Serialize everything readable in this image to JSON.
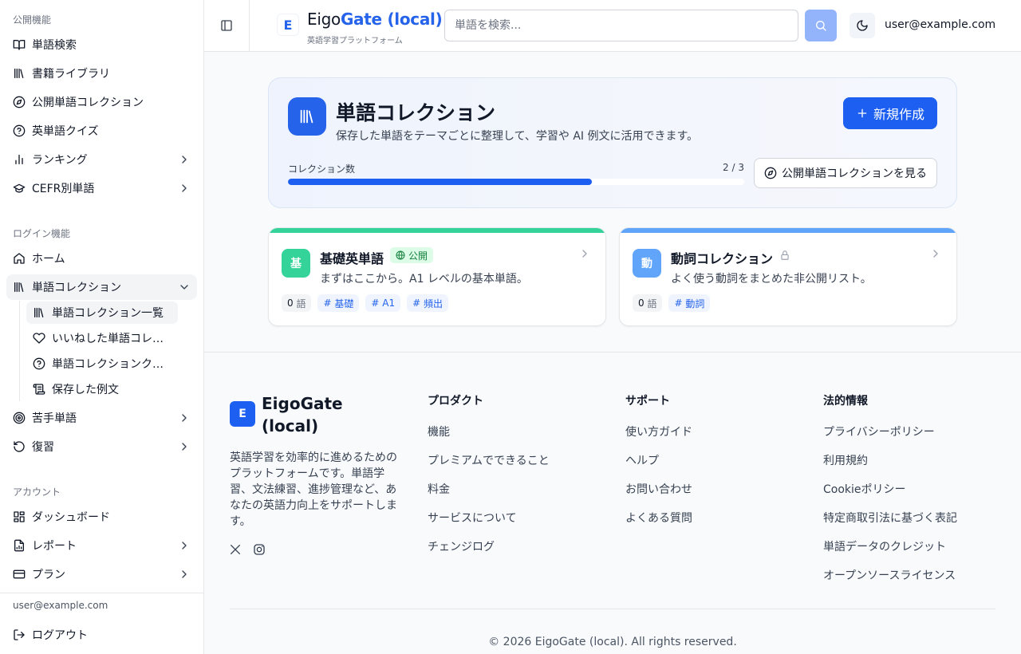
{
  "sidebar": {
    "sections": {
      "public": "公開機能",
      "login": "ログイン機能",
      "account": "アカウント"
    },
    "public_items": [
      {
        "label": "単語検索",
        "icon": "book-open-icon"
      },
      {
        "label": "書籍ライブラリ",
        "icon": "library-icon"
      },
      {
        "label": "公開単語コレクション",
        "icon": "compass-icon"
      },
      {
        "label": "英単語クイズ",
        "icon": "help-circle-icon"
      },
      {
        "label": "ランキング",
        "icon": "bar-chart-icon"
      },
      {
        "label": "CEFR別単語",
        "icon": "graduation-cap-icon"
      }
    ],
    "login_items": [
      {
        "label": "ホーム",
        "icon": "home-icon"
      },
      {
        "label": "単語コレクション",
        "icon": "library-icon"
      }
    ],
    "collection_sub": [
      {
        "label": "単語コレクション一覧",
        "icon": "library-icon"
      },
      {
        "label": "いいねした単語コレクション",
        "icon": "heart-icon"
      },
      {
        "label": "単語コレクションクイズ",
        "icon": "help-circle-icon"
      },
      {
        "label": "保存した例文",
        "icon": "scroll-icon"
      }
    ],
    "login_items_after": [
      {
        "label": "苦手単語",
        "icon": "target-icon"
      },
      {
        "label": "復習",
        "icon": "rotate-ccw-icon"
      }
    ],
    "account_items": [
      {
        "label": "ダッシュボード",
        "icon": "layout-dashboard-icon"
      },
      {
        "label": "レポート",
        "icon": "file-chart-icon"
      },
      {
        "label": "プラン",
        "icon": "credit-card-icon"
      }
    ],
    "user_email": "user@example.com",
    "logout_label": "ログアウト"
  },
  "header": {
    "logo_letter": "E",
    "brand_prefix": "Eigo",
    "brand_highlight": "Gate (local)",
    "tagline": "英語学習プラットフォーム",
    "search_placeholder": "単語を検索...",
    "user_email": "user@example.com"
  },
  "hero": {
    "title": "単語コレクション",
    "description": "保存した単語をテーマごとに整理して、学習や AI 例文に活用できます。",
    "new_button": "新規作成",
    "count_label": "コレクション数",
    "count_value": "2 / 3",
    "count_used": 2,
    "count_max": 3,
    "public_button": "公開単語コレクションを見る"
  },
  "cards": [
    {
      "avatar": "基",
      "title": "基礎英単語",
      "badge": "公開",
      "is_public": true,
      "description": "まずはここから。A1 レベルの基本単語。",
      "count_num": "0",
      "count_unit": "語",
      "tags": [
        "基礎",
        "A1",
        "頻出"
      ],
      "accent": "#34d399"
    },
    {
      "avatar": "動",
      "title": "動詞コレクション",
      "badge": "",
      "is_public": false,
      "description": "よく使う動詞をまとめた非公開リスト。",
      "count_num": "0",
      "count_unit": "語",
      "tags": [
        "動詞"
      ],
      "accent": "#60a5fa"
    }
  ],
  "footer": {
    "logo_letter": "E",
    "brand": "EigoGate (local)",
    "description": "英語学習を効率的に進めるためのプラットフォームです。単語学習、文法練習、進捗管理など、あなたの英語力向上をサポートします。",
    "columns": [
      {
        "title": "プロダクト",
        "links": [
          "機能",
          "プレミアムでできること",
          "料金",
          "サービスについて",
          "チェンジログ"
        ]
      },
      {
        "title": "サポート",
        "links": [
          "使い方ガイド",
          "ヘルプ",
          "お問い合わせ",
          "よくある質問"
        ]
      },
      {
        "title": "法的情報",
        "links": [
          "プライバシーポリシー",
          "利用規約",
          "Cookieポリシー",
          "特定商取引法に基づく表記",
          "単語データのクレジット",
          "オープンソースライセンス"
        ]
      }
    ],
    "copyright": "© 2026 EigoGate (local). All rights reserved."
  },
  "colors": {
    "accent": "#2563eb",
    "public_badge": "#15803d"
  }
}
